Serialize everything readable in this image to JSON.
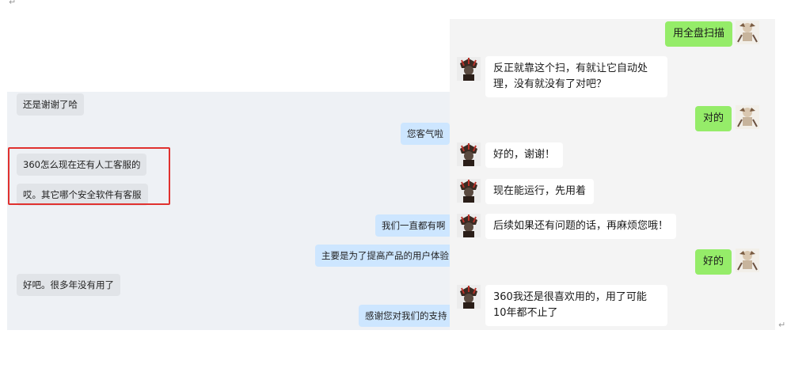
{
  "left_chat": {
    "messages": [
      {
        "side": "received",
        "text": "还是谢谢了哈"
      },
      {
        "side": "sent",
        "text": "您客气啦"
      },
      {
        "side": "received",
        "text": "360怎么现在还有人工客服的"
      },
      {
        "side": "received",
        "text": "哎。其它哪个安全软件有客服"
      },
      {
        "side": "sent",
        "text": "我们一直都有啊"
      },
      {
        "side": "sent",
        "text": "主要是为了提高产品的用户体验"
      },
      {
        "side": "received",
        "text": "好吧。很多年没有用了"
      },
      {
        "side": "sent",
        "text": "感谢您对我们的支持"
      }
    ]
  },
  "right_chat": {
    "messages": [
      {
        "side": "sent",
        "text": "用全盘扫描"
      },
      {
        "side": "received",
        "text": "反正就靠这个扫，有就让它自动处理，没有就没有了对吧？"
      },
      {
        "side": "sent",
        "text": "对的"
      },
      {
        "side": "received",
        "text": "好的，谢谢！"
      },
      {
        "side": "received",
        "text": "现在能运行，先用着"
      },
      {
        "side": "received",
        "text": "后续如果还有问题的话，再麻烦您哦！"
      },
      {
        "side": "sent",
        "text": "好的"
      },
      {
        "side": "received",
        "text": "360我还是很喜欢用的，用了可能10年都不止了"
      }
    ]
  },
  "colors": {
    "highlight_border": "#e0312f",
    "sent_bubble_right": "#95ec69",
    "sent_bubble_left": "#cde6ff",
    "received_bubble_left": "#e1e4e8",
    "received_bubble_right": "#ffffff"
  },
  "icons": {
    "paragraph_mark": "↵",
    "received_avatar": "warrior-avatar-icon",
    "sent_avatar": "cartoon-avatar-icon"
  }
}
